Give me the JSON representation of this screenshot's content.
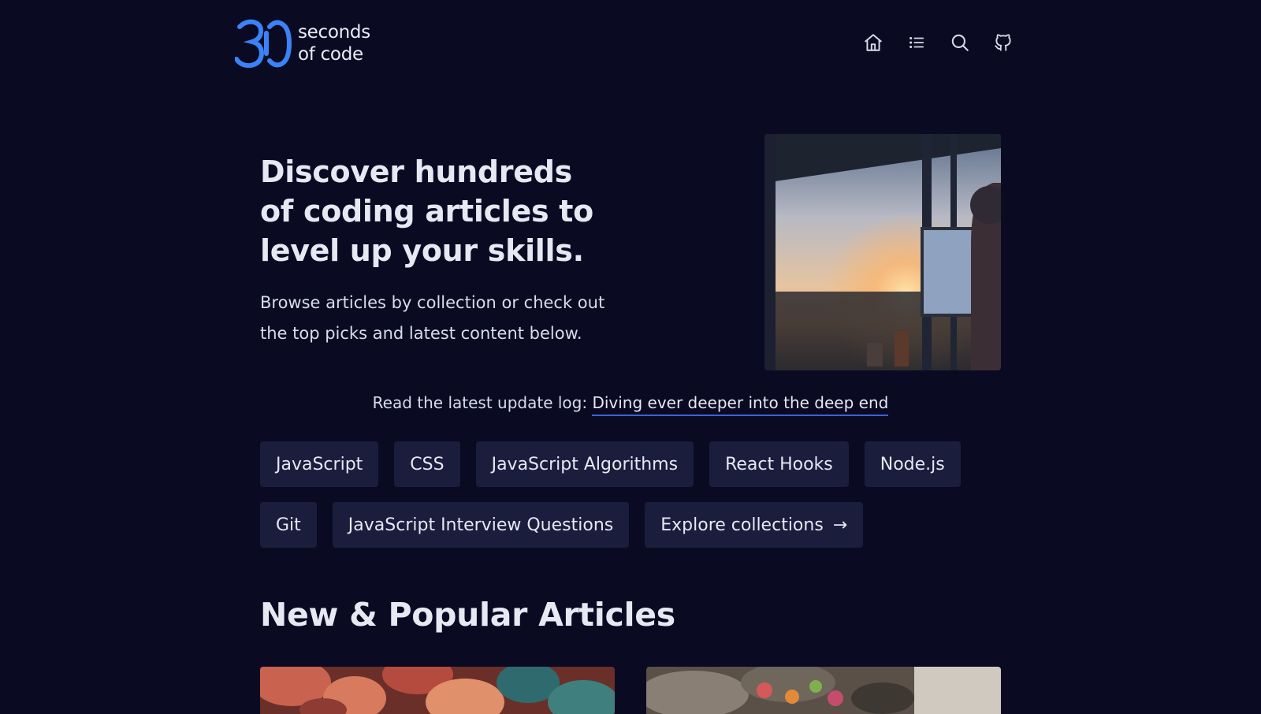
{
  "header": {
    "logo_text_line1": "seconds",
    "logo_text_line2": "of code",
    "nav": [
      {
        "icon": "home-icon"
      },
      {
        "icon": "list-icon"
      },
      {
        "icon": "search-icon"
      },
      {
        "icon": "github-icon"
      }
    ]
  },
  "hero": {
    "title": "Discover hundreds of coding articles to level up your skills.",
    "subtitle": "Browse articles by collection or check out the top picks and latest content below."
  },
  "update": {
    "prefix": "Read the latest update log:",
    "link_text": "Diving ever deeper into the deep end"
  },
  "collections": [
    "JavaScript",
    "CSS",
    "JavaScript Algorithms",
    "React Hooks",
    "Node.js",
    "Git",
    "JavaScript Interview Questions"
  ],
  "explore_label": "Explore collections",
  "section_title": "New & Popular Articles",
  "colors": {
    "background": "#0a0b22",
    "chip_bg": "#1b1d3d",
    "accent": "#3b82f6",
    "link_underline": "#3b63d8"
  }
}
